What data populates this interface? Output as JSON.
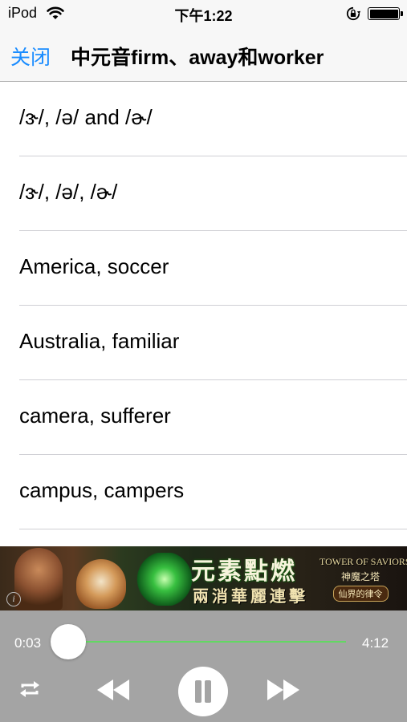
{
  "status_bar": {
    "carrier": "iPod",
    "time": "下午1:22",
    "battery_level": 1.0,
    "icons": [
      "wifi-icon",
      "orientation-lock-icon",
      "battery-icon"
    ]
  },
  "nav_bar": {
    "close_label": "关闭",
    "title": "中元音firm、away和worker"
  },
  "list": {
    "items": [
      {
        "label": "/ɝ/, /ə/ and /ɚ/"
      },
      {
        "label": "/ɝ/, /ə/, /ɚ/"
      },
      {
        "label": "America, soccer"
      },
      {
        "label": "Australia, familiar"
      },
      {
        "label": "camera, sufferer"
      },
      {
        "label": "campus, campers"
      }
    ]
  },
  "ad": {
    "headline": "元素點燃",
    "subline": "兩消華麗連擊",
    "logo_en": "TOWER OF SAVIORS",
    "logo_cn": "神魔之塔",
    "logo_tag": "仙界的律令",
    "info_label": "i"
  },
  "player": {
    "current_time": "0:03",
    "total_time": "4:12",
    "progress": 0.012,
    "colors": {
      "track": "#63d763",
      "background": "#a4a4a4"
    },
    "icons": [
      "repeat-icon",
      "rewind-icon",
      "pause-icon",
      "fast-forward-icon"
    ]
  },
  "colors": {
    "accent": "#1a8cff"
  }
}
